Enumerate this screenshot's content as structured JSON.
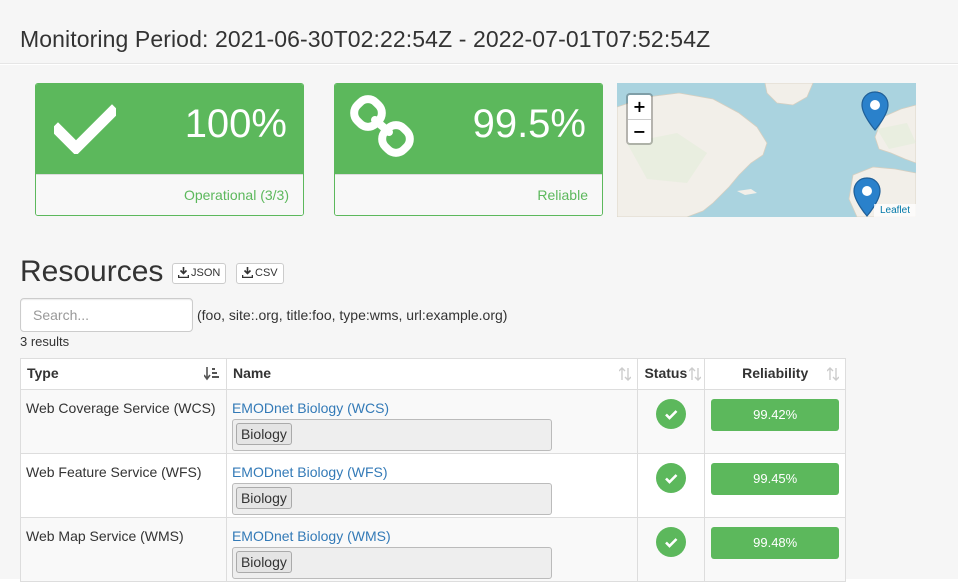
{
  "header": {
    "monitoring_period": "Monitoring Period: 2021-06-30T02:22:54Z - 2022-07-01T07:52:54Z"
  },
  "stats": [
    {
      "value": "100%",
      "label": "Operational (3/3)",
      "icon": "checkmark-icon"
    },
    {
      "value": "99.5%",
      "label": "Reliable",
      "icon": "link-icon"
    }
  ],
  "map": {
    "zoom_in": "+",
    "zoom_out": "−",
    "attribution": "Leaflet",
    "markers": [
      "map-marker-icon",
      "map-marker-icon"
    ]
  },
  "resources": {
    "title": "Resources",
    "json_label": "JSON",
    "csv_label": "CSV",
    "search_placeholder": "Search...",
    "search_hint": "(foo, site:.org, title:foo, type:wms, url:example.org)",
    "result_count": "3 results",
    "columns": [
      "Type",
      "Name",
      "Status",
      "Reliability"
    ],
    "rows": [
      {
        "type": "Web Coverage Service (WCS)",
        "name": "EMODnet Biology (WCS)",
        "tag": "Biology",
        "status": "ok",
        "reliability": "99.42%"
      },
      {
        "type": "Web Feature Service (WFS)",
        "name": "EMODnet Biology (WFS)",
        "tag": "Biology",
        "status": "ok",
        "reliability": "99.45%"
      },
      {
        "type": "Web Map Service (WMS)",
        "name": "EMODnet Biology (WMS)",
        "tag": "Biology",
        "status": "ok",
        "reliability": "99.48%"
      }
    ]
  },
  "colors": {
    "success": "#5cb85c",
    "link": "#337ab7"
  }
}
